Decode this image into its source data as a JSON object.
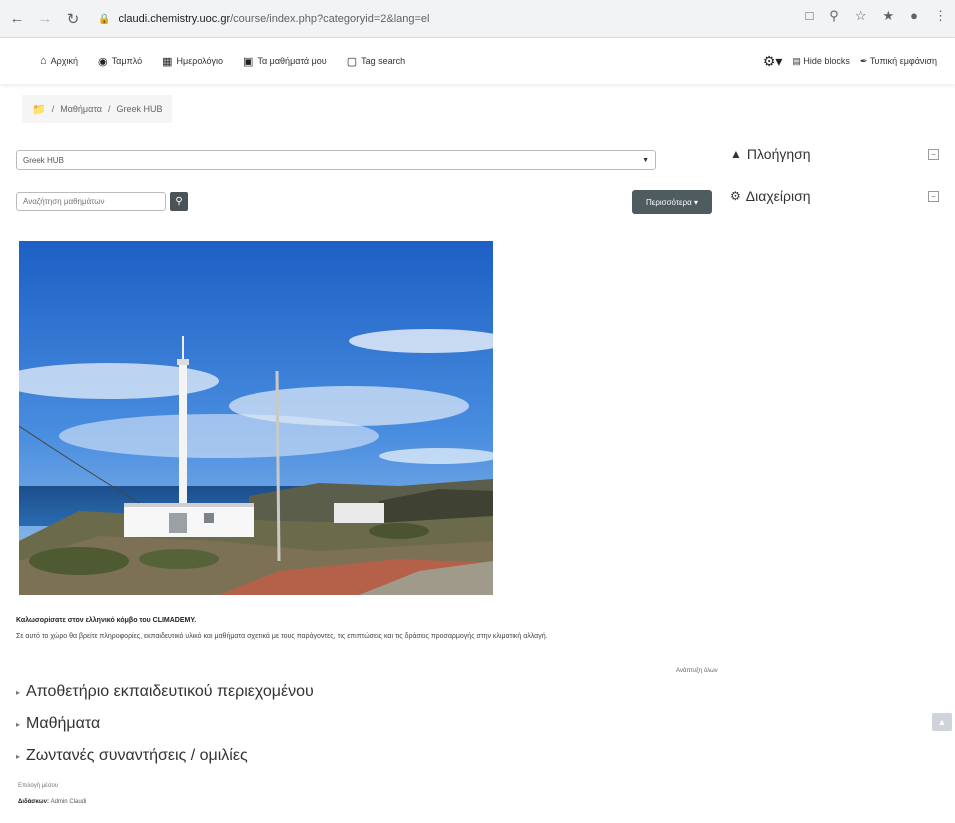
{
  "browser": {
    "url_host": "claudi.chemistry.uoc.gr",
    "url_path": "/course/index.php?categoryid=2&lang=el"
  },
  "navbar": {
    "items": [
      {
        "label": "Αρχική",
        "icon": "home-icon"
      },
      {
        "label": "Ταμπλό",
        "icon": "dashboard-icon"
      },
      {
        "label": "Ημερολόγιο",
        "icon": "calendar-icon"
      },
      {
        "label": "Τα μαθήματά μου",
        "icon": "briefcase-icon"
      },
      {
        "label": "Tag search",
        "icon": "tag-icon"
      }
    ],
    "hide_blocks": "Hide blocks",
    "standard_view": "Τυπική εμφάνιση"
  },
  "breadcrumb": {
    "items": [
      "Μαθήματα",
      "Greek HUB"
    ]
  },
  "category_select": {
    "value": "Greek HUB"
  },
  "search": {
    "placeholder": "Αναζήτηση μαθημάτων"
  },
  "more_button": "Περισσότερα",
  "blocks": [
    {
      "title": "Πλοήγηση",
      "icon": "sitemap-icon"
    },
    {
      "title": "Διαχείριση",
      "icon": "cogs-icon"
    }
  ],
  "welcome": {
    "title": "Καλωσορίσατε στον ελληνικό κόμβο του CLIMADEMY.",
    "body": "Σε αυτό το χώρο θα βρείτε πληροφορίες, εκπαιδευτικό υλικό και μαθήματα σχετικά με τους παράγοντες, τις επιπτώσεις και τις δράσεις προσαρμογής στην κλιματική αλλαγή.",
    "read_more": "Ανάπτυξη όλων"
  },
  "sections": [
    "Αποθετήριο εκπαιδευτικού περιεχομένου",
    "Μαθήματα",
    "Ζωντανές συναντήσεις / ομιλίες"
  ],
  "footer": {
    "line1": "Επιλογή μέσου",
    "teacher_label": "Διδάσκων:",
    "teacher_name": "Admin Claudi"
  }
}
